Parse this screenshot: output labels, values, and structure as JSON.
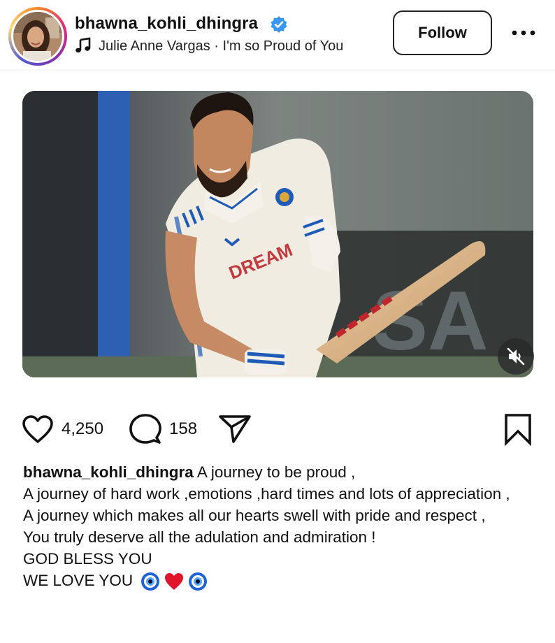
{
  "post": {
    "username": "bhawna_kohli_dhingra",
    "audio": "Julie Anne Vargas · I'm so Proud of You",
    "follow_label": "Follow"
  },
  "actions": {
    "likes": "4,250",
    "comments": "158"
  },
  "caption": {
    "username": "bhawna_kohli_dhingra",
    "line1": "A journey to be proud ,",
    "line2": "A journey of hard work ,emotions ,hard times and lots of appreciation ,",
    "line3": "A journey which makes all our hearts swell with pride and respect ,",
    "line4": "You truly deserve all the adulation and admiration !",
    "line5": "GOD BLESS YOU",
    "line6": "WE LOVE YOU"
  },
  "media": {
    "jersey_text": "DREAM"
  },
  "icons": {
    "verified": "verified-badge-icon",
    "music": "music-note-icon",
    "more": "more-options-icon",
    "mute": "muted-speaker-icon",
    "like": "heart-icon",
    "comment": "comment-icon",
    "share": "share-icon",
    "save": "bookmark-icon"
  },
  "colors": {
    "verified_blue": "#3897f0",
    "text": "#111111",
    "jersey_blue": "#1f5fb8",
    "heart_red": "#e0152c"
  }
}
